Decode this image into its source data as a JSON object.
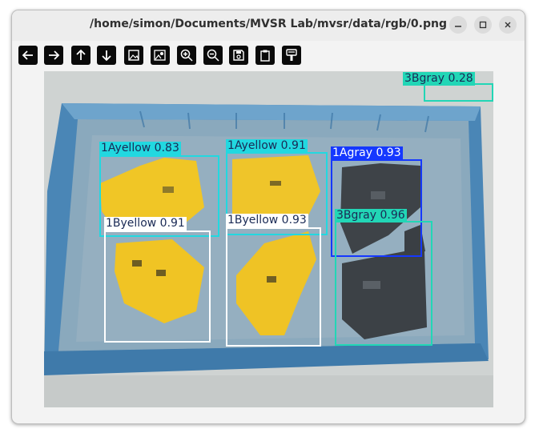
{
  "window": {
    "title": "/home/simon/Documents/MVSR Lab/mvsr/data/rgb/0.png"
  },
  "window_controls": [
    "minimize-icon",
    "maximize-icon",
    "close-icon"
  ],
  "toolbar": {
    "buttons": [
      {
        "name": "back-button",
        "icon": "arrow-left-icon"
      },
      {
        "name": "forward-button",
        "icon": "arrow-right-icon"
      },
      {
        "name": "up-button",
        "icon": "arrow-up-icon"
      },
      {
        "name": "down-button",
        "icon": "arrow-down-icon"
      },
      {
        "name": "fit-image-button",
        "icon": "image-icon"
      },
      {
        "name": "image-settings-button",
        "icon": "image-person-icon"
      },
      {
        "name": "zoom-in-button",
        "icon": "zoom-in-icon"
      },
      {
        "name": "zoom-out-button",
        "icon": "zoom-out-icon"
      },
      {
        "name": "save-button",
        "icon": "save-icon"
      },
      {
        "name": "clipboard-button",
        "icon": "clipboard-icon"
      },
      {
        "name": "paint-button",
        "icon": "paint-icon"
      }
    ]
  },
  "detections": [
    {
      "label": "3Bgray 0.28",
      "color": "#22d6b6",
      "text_color": "#1a2a55"
    },
    {
      "label": "1Ayellow 0.83",
      "color": "#22d8e0",
      "text_color": "#1a2a55"
    },
    {
      "label": "1Ayellow 0.91",
      "color": "#22d8e0",
      "text_color": "#1a2a55"
    },
    {
      "label": "1Agray 0.93",
      "color": "#1538ff",
      "text_color": "#ffffff"
    },
    {
      "label": "1Byellow 0.91",
      "color": "#ffffff",
      "text_color": "#1a2a55"
    },
    {
      "label": "1Byellow 0.93",
      "color": "#ffffff",
      "text_color": "#1a2a55"
    },
    {
      "label": "3Bgray 0.96",
      "color": "#22d6b6",
      "text_color": "#1a2a55"
    }
  ]
}
